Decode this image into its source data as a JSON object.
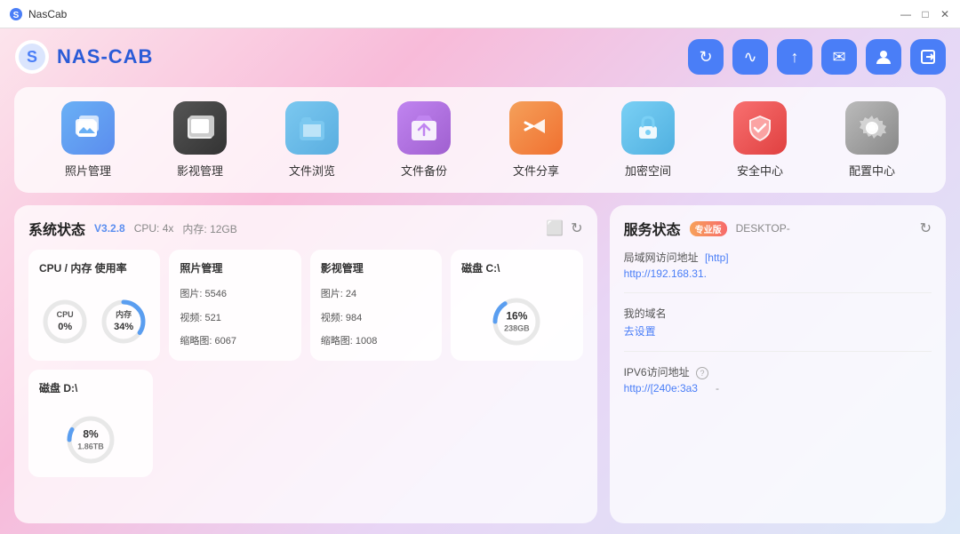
{
  "titlebar": {
    "title": "NasCab",
    "logo": "S",
    "minimize": "—",
    "maximize": "□",
    "close": "✕"
  },
  "header": {
    "logo_text": "NAS-CAB",
    "toolbar_buttons": [
      {
        "id": "refresh",
        "icon": "↻",
        "label": "刷新"
      },
      {
        "id": "pulse",
        "icon": "⚡",
        "label": "状态"
      },
      {
        "id": "upload",
        "icon": "↑",
        "label": "上传"
      },
      {
        "id": "mail",
        "icon": "✉",
        "label": "邮件"
      },
      {
        "id": "user",
        "icon": "👤",
        "label": "用户"
      },
      {
        "id": "exit",
        "icon": "⏏",
        "label": "退出"
      }
    ]
  },
  "apps": [
    {
      "id": "photos",
      "label": "照片管理",
      "icon": "📁",
      "color": "#e8f0fe"
    },
    {
      "id": "media",
      "label": "影视管理",
      "icon": "📂",
      "color": "#e8f0fe"
    },
    {
      "id": "files",
      "label": "文件浏览",
      "icon": "📁",
      "color": "#e8f0fe"
    },
    {
      "id": "backup",
      "label": "文件备份",
      "icon": "📬",
      "color": "#f3e8fe"
    },
    {
      "id": "share",
      "label": "文件分享",
      "icon": "📤",
      "color": "#fff3e0"
    },
    {
      "id": "encrypt",
      "label": "加密空间",
      "icon": "🔒",
      "color": "#e8f4fe"
    },
    {
      "id": "security",
      "label": "安全中心",
      "icon": "🛡",
      "color": "#fde8e8"
    },
    {
      "id": "config",
      "label": "配置中心",
      "icon": "⚙",
      "color": "#f5f5f5"
    }
  ],
  "system_status": {
    "section_title": "系统状态",
    "version": "V3.2.8",
    "cpu_info": "CPU: 4x",
    "mem_info": "内存: 12GB",
    "cpu_label": "CPU",
    "cpu_value": "0%",
    "mem_label": "内存",
    "mem_value": "34%",
    "cpu_percent": 0,
    "mem_percent": 34,
    "photos_title": "照片管理",
    "photos_images": "图片: 5546",
    "photos_videos": "视频: 521",
    "photos_thumbs": "缩略图: 6067",
    "media_title": "影视管理",
    "media_images": "图片: 24",
    "media_videos": "视频: 984",
    "media_thumbs": "缩略图: 1008",
    "disk_c_title": "磁盘 C:\\",
    "disk_c_percent": 16,
    "disk_c_value": "16%",
    "disk_c_size": "238GB",
    "disk_d_title": "磁盘 D:\\",
    "disk_d_percent": 8,
    "disk_d_value": "8%",
    "disk_d_size": "1.86TB",
    "cpu_mem_title": "CPU / 内存 使用率"
  },
  "service_status": {
    "section_title": "服务状态",
    "badge": "专业版",
    "hostname": "DESKTOP-",
    "lan_label": "局域网访问地址",
    "lan_protocol": "[http]",
    "lan_url": "http://192.168.31.",
    "domain_label": "我的域名",
    "domain_value": "去设置",
    "ipv6_label": "IPV6访问地址",
    "ipv6_help": "?",
    "ipv6_url": "http://[240e:3a3",
    "ipv6_dash": "-"
  }
}
